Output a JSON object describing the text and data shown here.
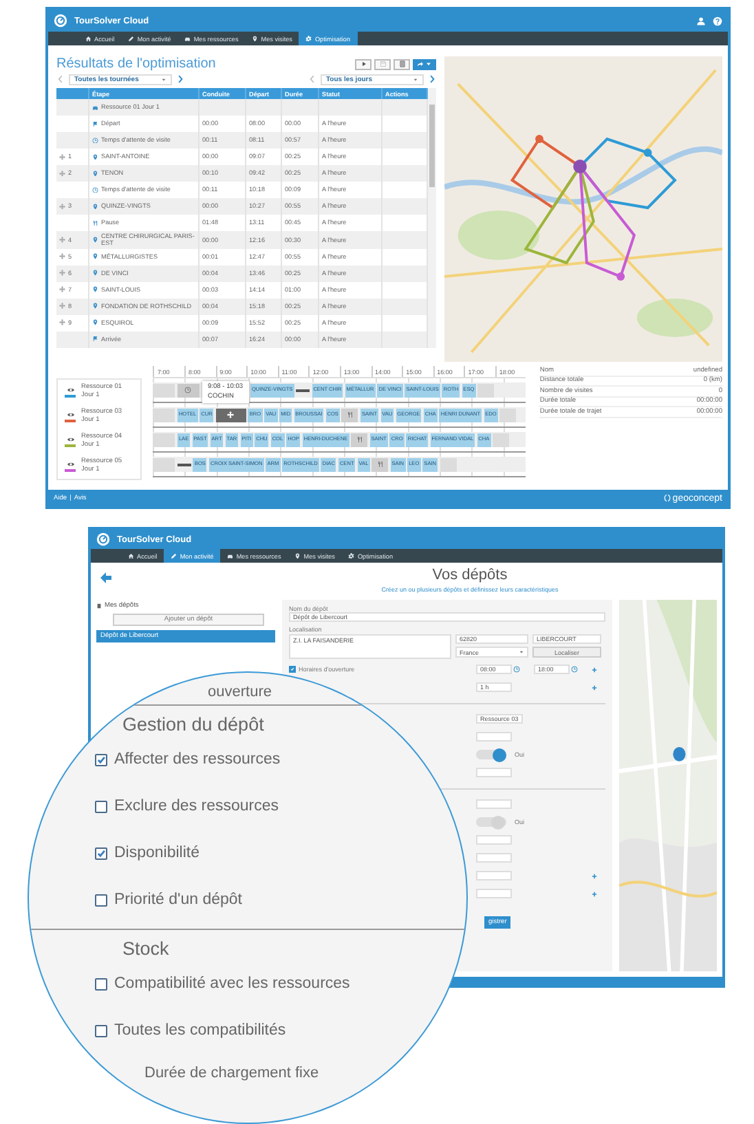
{
  "results": {
    "app_title": "TourSolver Cloud",
    "nav": [
      {
        "label": "Accueil",
        "selected": false
      },
      {
        "label": "Mon activité",
        "selected": false
      },
      {
        "label": "Mes ressources",
        "selected": false
      },
      {
        "label": "Mes visites",
        "selected": false
      },
      {
        "label": "Optimisation",
        "selected": true
      }
    ],
    "page_title": "Résultats de l'optimisation",
    "toolbar": [
      {
        "disabled": false
      },
      {
        "disabled": true
      },
      {
        "disabled": false
      },
      {
        "disabled": false
      }
    ],
    "tour_filter": "Toutes les tournées",
    "day_filter": "Tous les jours",
    "table": {
      "columns": [
        "Étape",
        "Conduite",
        "Départ",
        "Durée",
        "Statut",
        "Actions"
      ],
      "rows": [
        {
          "kind": "resource",
          "step": "Ressource 01 Jour 1"
        },
        {
          "kind": "start",
          "step": "Départ",
          "drive": "00:00",
          "departure": "08:00",
          "duration": "00:00",
          "status": "A l'heure"
        },
        {
          "kind": "wait",
          "step": "Temps d'attente de visite",
          "drive": "00:11",
          "departure": "08:11",
          "duration": "00:57",
          "status": "A l'heure"
        },
        {
          "kind": "visit",
          "number": "1",
          "step": "SAINT-ANTOINE",
          "drive": "00:00",
          "departure": "09:07",
          "duration": "00:25",
          "status": "A l'heure"
        },
        {
          "kind": "visit",
          "number": "2",
          "step": "TENON",
          "drive": "00:10",
          "departure": "09:42",
          "duration": "00:25",
          "status": "A l'heure"
        },
        {
          "kind": "wait",
          "step": "Temps d'attente de visite",
          "drive": "00:11",
          "departure": "10:18",
          "duration": "00:09",
          "status": "A l'heure"
        },
        {
          "kind": "visit",
          "number": "3",
          "step": "QUINZE-VINGTS",
          "drive": "00:00",
          "departure": "10:27",
          "duration": "00:55",
          "status": "A l'heure"
        },
        {
          "kind": "break",
          "step": "Pause",
          "drive": "01:48",
          "departure": "13:11",
          "duration": "00:45",
          "status": "A l'heure"
        },
        {
          "kind": "visit",
          "number": "4",
          "step": "CENTRE CHIRURGICAL PARIS-EST",
          "drive": "00:00",
          "departure": "12:16",
          "duration": "00:30",
          "status": "A l'heure"
        },
        {
          "kind": "visit",
          "number": "5",
          "step": "MÉTALLURGISTES",
          "drive": "00:01",
          "departure": "12:47",
          "duration": "00:55",
          "status": "A l'heure"
        },
        {
          "kind": "visit",
          "number": "6",
          "step": "DE VINCI",
          "drive": "00:04",
          "departure": "13:46",
          "duration": "00:25",
          "status": "A l'heure"
        },
        {
          "kind": "visit",
          "number": "7",
          "step": "SAINT-LOUIS",
          "drive": "00:03",
          "departure": "14:14",
          "duration": "01:00",
          "status": "A l'heure"
        },
        {
          "kind": "visit",
          "number": "8",
          "step": "FONDATION DE ROTHSCHILD",
          "drive": "00:04",
          "departure": "15:18",
          "duration": "00:25",
          "status": "A l'heure"
        },
        {
          "kind": "visit",
          "number": "9",
          "step": "ESQUIROL",
          "drive": "00:09",
          "departure": "15:52",
          "duration": "00:25",
          "status": "A l'heure"
        },
        {
          "kind": "end",
          "step": "Arrivée",
          "drive": "00:07",
          "departure": "16:24",
          "duration": "00:00",
          "status": "A l'heure"
        }
      ]
    },
    "gantt": {
      "hours": [
        "7:00",
        "8:00",
        "9:00",
        "10:00",
        "11:00",
        "12:00",
        "13:00",
        "14:00",
        "15:00",
        "16:00",
        "17:00",
        "18:00"
      ],
      "tooltip": {
        "time": "9:08 - 10:03",
        "label": "COCHIN"
      },
      "resources": [
        {
          "name": "Ressource 01",
          "day": "Jour 1",
          "color": "#2e9bd6",
          "tasks": [
            {
              "kind": "idle"
            },
            {
              "kind": "wait"
            },
            {
              "kind": "gap"
            },
            {
              "kind": "visit",
              "label": "QUINZE-VINGTS"
            },
            {
              "kind": "travel"
            },
            {
              "kind": "visit",
              "label": "CENT CHIR"
            },
            {
              "kind": "visit",
              "label": "MÉTALLUR"
            },
            {
              "kind": "visit",
              "label": "DE VINCI"
            },
            {
              "kind": "visit",
              "label": "SAINT-LOUIS"
            },
            {
              "kind": "visit",
              "label": "ROTH"
            },
            {
              "kind": "visit",
              "label": "ESQ"
            },
            {
              "kind": "idle"
            }
          ]
        },
        {
          "name": "Ressource 03",
          "day": "Jour 1",
          "color": "#e0623f",
          "tasks": [
            {
              "kind": "idle"
            },
            {
              "kind": "visit",
              "label": "HOTEL"
            },
            {
              "kind": "visit",
              "label": "CUR"
            },
            {
              "kind": "moving"
            },
            {
              "kind": "visit",
              "label": "BRO"
            },
            {
              "kind": "visit",
              "label": "VAU"
            },
            {
              "kind": "visit",
              "label": "MID"
            },
            {
              "kind": "visit",
              "label": "BROUSSAI"
            },
            {
              "kind": "visit",
              "label": "COS"
            },
            {
              "kind": "break"
            },
            {
              "kind": "visit",
              "label": "SAINT"
            },
            {
              "kind": "visit",
              "label": "VAU"
            },
            {
              "kind": "visit",
              "label": "GEORGE"
            },
            {
              "kind": "visit",
              "label": "CHA"
            },
            {
              "kind": "visit",
              "label": "HENRI DUNANT"
            },
            {
              "kind": "visit",
              "label": "EDO"
            },
            {
              "kind": "idle"
            }
          ]
        },
        {
          "name": "Ressource 04",
          "day": "Jour 1",
          "color": "#9cb53b",
          "tasks": [
            {
              "kind": "idle"
            },
            {
              "kind": "visit",
              "label": "LAE"
            },
            {
              "kind": "visit",
              "label": "PAST"
            },
            {
              "kind": "visit",
              "label": "ART"
            },
            {
              "kind": "visit",
              "label": "TAR"
            },
            {
              "kind": "visit",
              "label": "PITI"
            },
            {
              "kind": "visit",
              "label": "CHU"
            },
            {
              "kind": "visit",
              "label": "COL"
            },
            {
              "kind": "visit",
              "label": "HOP"
            },
            {
              "kind": "visit",
              "label": "HENRI-DUCHENE"
            },
            {
              "kind": "break"
            },
            {
              "kind": "visit",
              "label": "SAINT"
            },
            {
              "kind": "visit",
              "label": "CRO"
            },
            {
              "kind": "visit",
              "label": "RICHAT"
            },
            {
              "kind": "visit",
              "label": "FERNAND VIDAL"
            },
            {
              "kind": "visit",
              "label": "CHA"
            },
            {
              "kind": "idle"
            }
          ]
        },
        {
          "name": "Ressource 05",
          "day": "Jour 1",
          "color": "#c85bd4",
          "tasks": [
            {
              "kind": "idle"
            },
            {
              "kind": "travel"
            },
            {
              "kind": "visit",
              "label": "BOS"
            },
            {
              "kind": "visit",
              "label": "CROIX SAINT-SIMON"
            },
            {
              "kind": "visit",
              "label": "ARM"
            },
            {
              "kind": "visit",
              "label": "ROTHSCHILD"
            },
            {
              "kind": "visit",
              "label": "DIAC"
            },
            {
              "kind": "visit",
              "label": "CENT"
            },
            {
              "kind": "visit",
              "label": "VAL"
            },
            {
              "kind": "break"
            },
            {
              "kind": "visit",
              "label": "SAIN"
            },
            {
              "kind": "visit",
              "label": "LEO"
            },
            {
              "kind": "visit",
              "label": "SAIN"
            },
            {
              "kind": "idle"
            }
          ]
        }
      ]
    },
    "summary": [
      {
        "label": "Nom",
        "value": "undefined"
      },
      {
        "label": "Distance totale",
        "value": "0 (km)"
      },
      {
        "label": "Nombre de visites",
        "value": "0"
      },
      {
        "label": "Durée totale",
        "value": "00:00:00"
      },
      {
        "label": "Durée totale de trajet",
        "value": "00:00:00"
      }
    ],
    "footer": {
      "links": [
        "Aide",
        "Avis"
      ],
      "separator": "|",
      "brand": "geoconcept"
    }
  },
  "depots": {
    "app_title": "TourSolver Cloud",
    "nav": [
      {
        "label": "Accueil",
        "selected": false
      },
      {
        "label": "Mon activité",
        "selected": true
      },
      {
        "label": "Mes ressources",
        "selected": false
      },
      {
        "label": "Mes visites",
        "selected": false
      },
      {
        "label": "Optimisation",
        "selected": false
      }
    ],
    "page_title": "Vos dépôts",
    "subtitle": "Créez un ou plusieurs dépôts et définissez leurs caractéristiques",
    "list_title": "Mes dépôts",
    "add_button": "Ajouter un dépôt",
    "items": [
      {
        "name": "Dépôt de Libercourt",
        "selected": true
      }
    ],
    "form": {
      "name_label": "Nom du dépôt",
      "name_value": "Dépôt de Libercourt",
      "location_label": "Localisation",
      "address": "Z.I. LA FAISANDERIE",
      "postcode": "62820",
      "city": "LIBERCOURT",
      "country": "France",
      "locate_button": "Localiser",
      "hours": {
        "label": "Horaires d'ouverture",
        "checked": true,
        "open": "08:00",
        "close": "18:00"
      },
      "rows": [
        {
          "kind": "field",
          "value": "1 h",
          "add": true
        },
        {
          "kind": "divider"
        },
        {
          "kind": "field",
          "value": "Ressource 03"
        },
        {
          "kind": "field"
        },
        {
          "kind": "toggle",
          "on": true,
          "label": "Oui"
        },
        {
          "kind": "field"
        },
        {
          "kind": "divider"
        },
        {
          "kind": "field"
        },
        {
          "kind": "toggle",
          "on": false,
          "label": "Oui"
        },
        {
          "kind": "field"
        },
        {
          "kind": "field"
        },
        {
          "kind": "field",
          "add": true
        },
        {
          "kind": "field",
          "add": true
        }
      ],
      "save_button": "gistrer"
    }
  },
  "lens": {
    "items": [
      {
        "kind": "text",
        "text": "ouverture"
      },
      {
        "kind": "heading",
        "text": "Gestion du dépôt"
      },
      {
        "kind": "checkbox",
        "label": "Affecter des ressources",
        "checked": true
      },
      {
        "kind": "checkbox",
        "label": "Exclure des ressources",
        "checked": false
      },
      {
        "kind": "checkbox",
        "label": "Disponibilité",
        "checked": true
      },
      {
        "kind": "checkbox",
        "label": "Priorité d'un dépôt",
        "checked": false
      },
      {
        "kind": "heading",
        "text": "Stock"
      },
      {
        "kind": "checkbox",
        "label": "Compatibilité avec les ressources",
        "checked": false
      },
      {
        "kind": "checkbox",
        "label": "Toutes les compatibilités",
        "checked": false
      },
      {
        "kind": "text",
        "text": "Durée de chargement fixe"
      }
    ]
  }
}
